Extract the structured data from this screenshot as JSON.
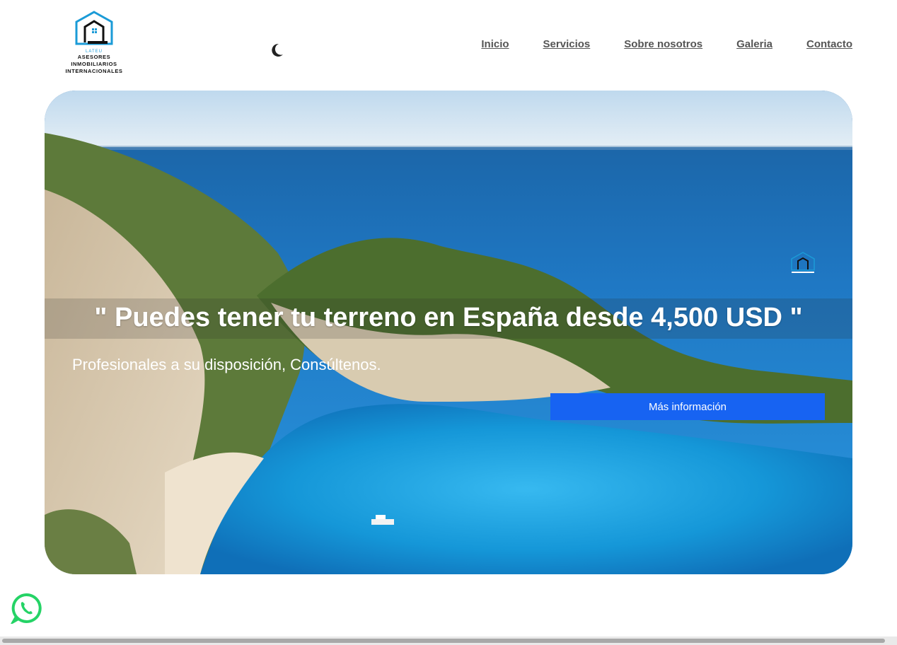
{
  "brand": {
    "short_name": "LATEU",
    "line1": "ASESORES INMOBILIARIOS",
    "line2": "INTERNACIONALES",
    "accent_color": "#1b9bd7"
  },
  "header": {
    "theme_toggle_icon": "moon-icon",
    "nav": {
      "home": "Inicio",
      "services": "Servicios",
      "about": "Sobre nosotros",
      "gallery": "Galeria",
      "contact": "Contacto"
    }
  },
  "hero": {
    "title": "\" Puedes tener tu terreno en España desde 4,500 USD \"",
    "subtitle": "Profesionales a su disposición, Consúltenos.",
    "button_label": "Más información",
    "button_color": "#1763f2"
  },
  "floating": {
    "whatsapp_icon": "whatsapp-icon",
    "whatsapp_color": "#25d366"
  }
}
